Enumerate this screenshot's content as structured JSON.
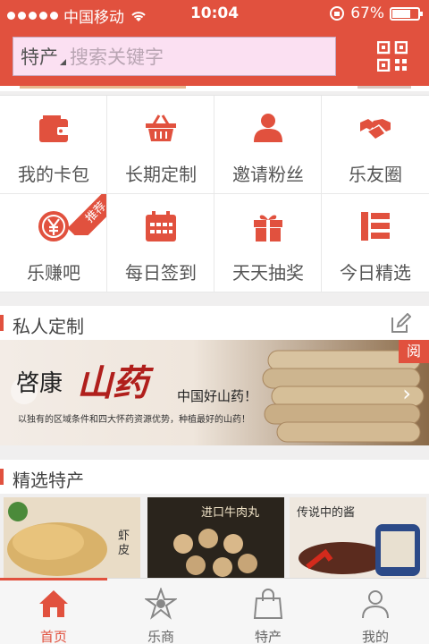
{
  "status_bar": {
    "carrier": "中国移动",
    "time": "10:04",
    "battery": "67%"
  },
  "header": {
    "category": "特产",
    "search_placeholder": "搜索关键字"
  },
  "grid": [
    {
      "label": "我的卡包",
      "icon": "wallet-icon"
    },
    {
      "label": "长期定制",
      "icon": "basket-icon"
    },
    {
      "label": "邀请粉丝",
      "icon": "person-icon"
    },
    {
      "label": "乐友圈",
      "icon": "handshake-icon"
    },
    {
      "label": "乐赚吧",
      "icon": "yuan-coin-icon",
      "badge": "推荐"
    },
    {
      "label": "每日签到",
      "icon": "calendar-icon"
    },
    {
      "label": "天天抽奖",
      "icon": "gift-icon"
    },
    {
      "label": "今日精选",
      "icon": "list-icon"
    }
  ],
  "sections": {
    "custom": "私人定制",
    "featured": "精选特产"
  },
  "banner": {
    "brand_prefix": "啓康",
    "brand_big": "山药",
    "slogan": "中国好山药！",
    "subtitle": "以独有的区域条件和四大怀药资源优势，种植最好的山药！",
    "flag": "阅"
  },
  "products": [
    {
      "caption": "虾皮"
    },
    {
      "caption": "进口牛肉丸"
    },
    {
      "caption": "传说中的酱"
    }
  ],
  "tabs": [
    {
      "label": "首页",
      "icon": "home-icon",
      "active": true
    },
    {
      "label": "乐商",
      "icon": "star-badge-icon"
    },
    {
      "label": "特产",
      "icon": "shopping-bag-icon"
    },
    {
      "label": "我的",
      "icon": "user-icon"
    }
  ],
  "colors": {
    "accent": "#e1513e",
    "search_bg": "#fbe0f2"
  }
}
